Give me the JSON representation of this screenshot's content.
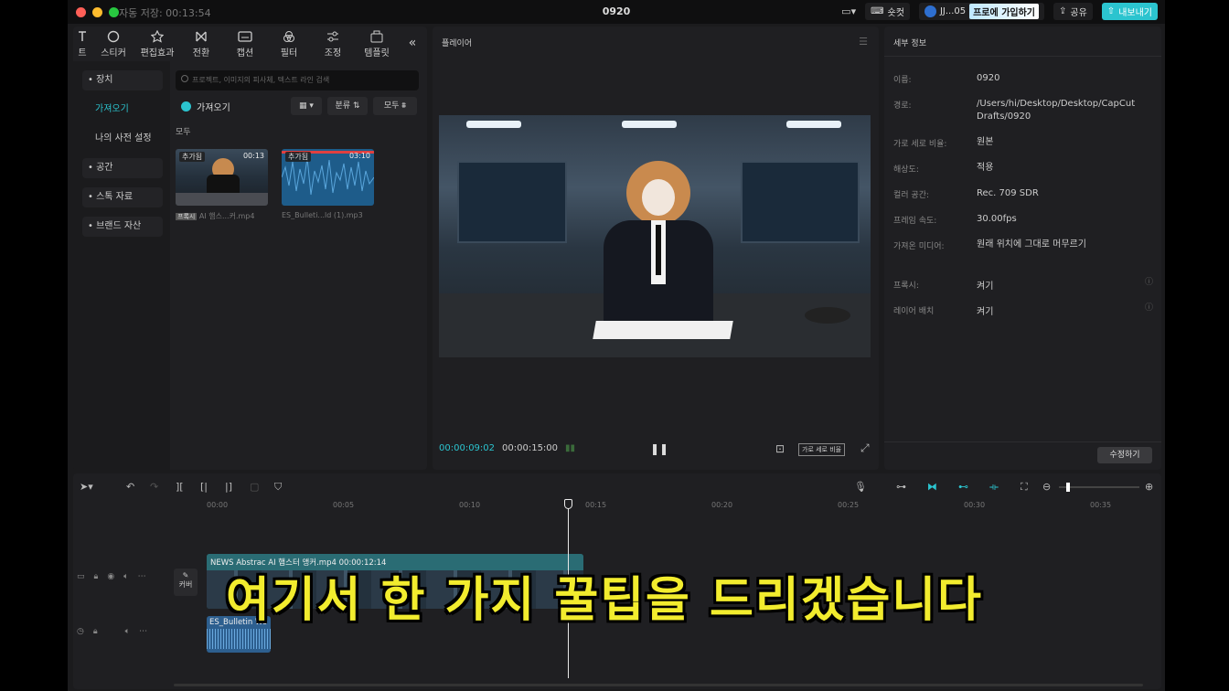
{
  "titlebar": {
    "autosave": "자동 저장: 00:13:54",
    "title": "0920",
    "shortcut": "숏컷",
    "user": "JJ...05",
    "pro": "프로에 가입하기",
    "share": "공유",
    "export": "내보내기"
  },
  "toolbar": {
    "tools": [
      "트",
      "스티커",
      "편집효과",
      "전환",
      "캡션",
      "필터",
      "조정",
      "템플릿"
    ]
  },
  "sidenav": {
    "items": [
      "• 장치",
      "가져오기",
      "나의 사전 설정",
      "• 공간",
      "• 스톡 자료",
      "• 브랜드 자산"
    ]
  },
  "media": {
    "search_placeholder": "프로젝트, 이미지의 피사체, 텍스트 라인 검색",
    "import": "가져오기",
    "sort": "분류",
    "filter_all": "모두",
    "section": "모두",
    "items": [
      {
        "badge": "추가됨",
        "duration": "00:13",
        "tag": "프록시",
        "name": "AI 햄스...커.mp4"
      },
      {
        "badge": "추가됨",
        "duration": "03:10",
        "name": "ES_Bulleti...ld (1).mp3"
      }
    ]
  },
  "player": {
    "title": "플레이어",
    "current": "00:00:09:02",
    "total": "00:00:15:00",
    "ratio_btn": "가로 세로 비율"
  },
  "details": {
    "title": "세부 정보",
    "rows": [
      {
        "label": "이름:",
        "value": "0920"
      },
      {
        "label": "경로:",
        "value": "/Users/hi/Desktop/Desktop/CapCut Drafts/0920"
      },
      {
        "label": "가로 세로 비율:",
        "value": "원본"
      },
      {
        "label": "해상도:",
        "value": "적용"
      },
      {
        "label": "컬러 공간:",
        "value": "Rec. 709 SDR"
      },
      {
        "label": "프레임 속도:",
        "value": "30.00fps"
      },
      {
        "label": "가져온 미디어:",
        "value": "원래 위치에 그대로 머무르기"
      }
    ],
    "proxy_label": "프록시:",
    "proxy_value": "켜기",
    "layer_label": "레이어 배치",
    "layer_value": "켜기",
    "edit_btn": "수정하기"
  },
  "timeline": {
    "ticks": [
      "00:00",
      "00:05",
      "00:10",
      "00:15",
      "00:20",
      "00:25",
      "00:30",
      "00:35"
    ],
    "cover": "커버",
    "video_clip": "NEWS Abstrac  AI 햄스터 앵커.mp4   00:00:12:14",
    "audio_clip": "ES_Bulletin Wo",
    "playhead_progress": 0.6
  },
  "subtitle": "여기서 한 가지 꿀팁을 드리겠습니다",
  "colors": {
    "accent": "#2bc4cf",
    "subtitle": "#f2ec2e",
    "export": "#2bc4cf"
  }
}
